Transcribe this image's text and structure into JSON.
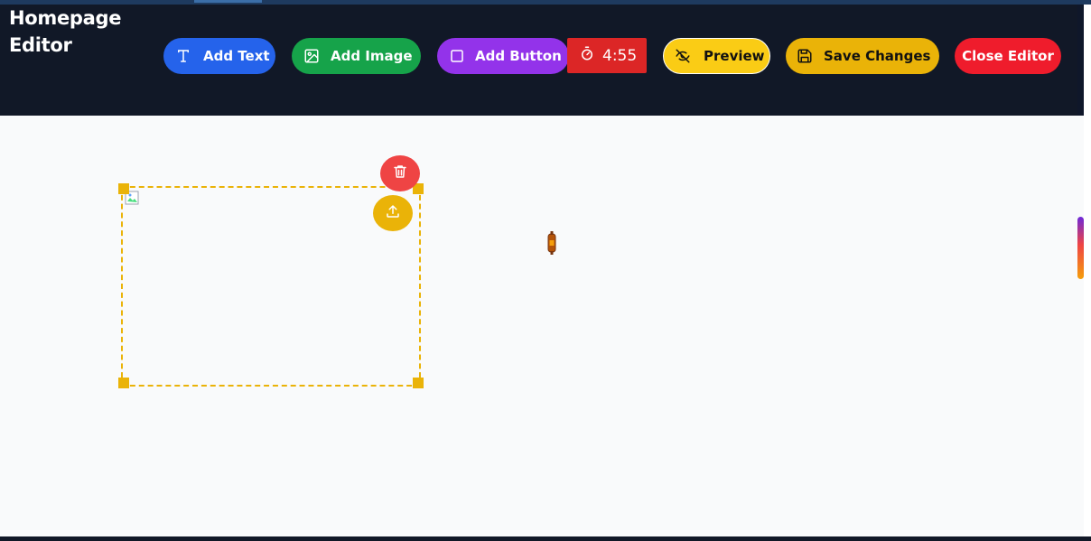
{
  "header": {
    "title_line1": "Homepage",
    "title_line2": "Editor"
  },
  "toolbar": {
    "add_text_label": "Add Text",
    "add_image_label": "Add Image",
    "add_button_label": "Add Button",
    "timer_value": "4:55",
    "preview_label": "Preview",
    "save_label": "Save Changes",
    "close_label": "Close Editor"
  },
  "icons": {
    "add_text": "text-t-icon",
    "add_image": "image-icon",
    "add_button": "square-icon",
    "timer": "stopwatch-icon",
    "preview": "eye-off-icon",
    "save": "floppy-disk-icon",
    "delete": "trash-icon",
    "upload": "upload-icon"
  },
  "colors": {
    "header_bg": "#111827",
    "add_text": "#2563eb",
    "add_image": "#16a34a",
    "add_button": "#9333ea",
    "timer": "#dc2626",
    "preview": "#facc15",
    "save": "#eab308",
    "close": "#ef1c2c",
    "selection": "#eab308",
    "delete": "#ef4444"
  }
}
